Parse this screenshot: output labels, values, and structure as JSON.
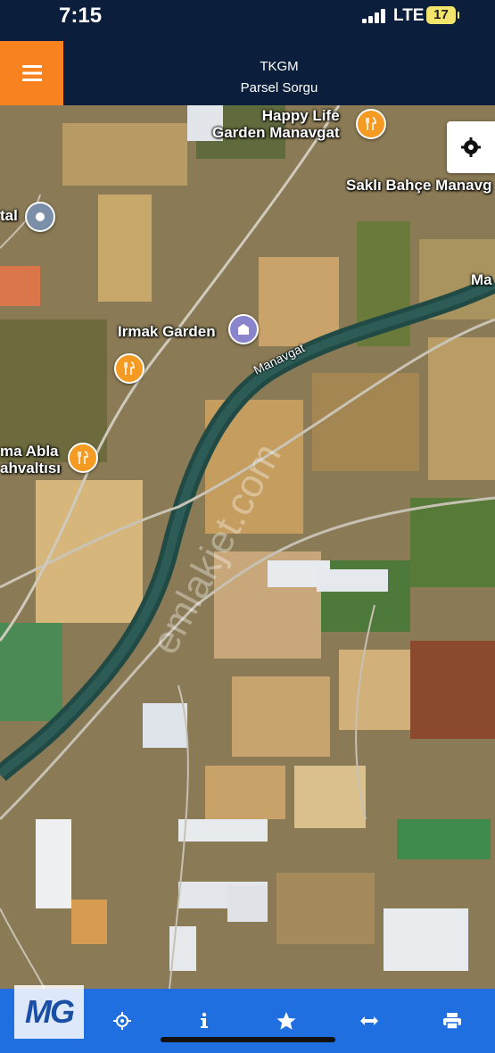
{
  "status_bar": {
    "time": "7:15",
    "network": "LTE",
    "battery": "17"
  },
  "header": {
    "title": "TKGM",
    "subtitle": "Parsel Sorgu",
    "menu_icon": "hamburger-icon"
  },
  "map": {
    "labels": {
      "happy_life": "Happy Life\nGarden Manavgat",
      "sakli_bahce": "Saklı Bahçe Manavg",
      "tal": "tal",
      "ma": "Ma",
      "irmak": "Irmak Garden",
      "river": "Manavgat",
      "abla": "ma Abla\nahvaltısı"
    },
    "watermark": "emlakjet.com",
    "settings_icon": "gear-icon"
  },
  "toolbar": {
    "items": [
      {
        "name": "locate",
        "icon": "crosshair-icon"
      },
      {
        "name": "info",
        "icon": "info-icon"
      },
      {
        "name": "favorite",
        "icon": "star-icon"
      },
      {
        "name": "measure",
        "icon": "arrows-horizontal-icon"
      },
      {
        "name": "print",
        "icon": "printer-icon"
      }
    ],
    "logo": "MG"
  }
}
